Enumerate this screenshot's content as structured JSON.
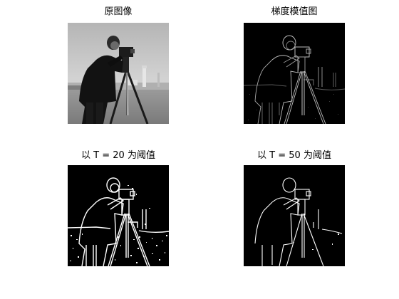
{
  "panels": [
    {
      "title": "原图像"
    },
    {
      "title": "梯度模值图"
    },
    {
      "title": "以 T = 20 为阈值"
    },
    {
      "title": "以 T = 50 为阈值"
    }
  ],
  "colors": {
    "background": "#ffffff",
    "title_text": "#000000",
    "image_black": "#000000",
    "image_white": "#ffffff",
    "original_sky": "#c9c9c9",
    "original_ground": "#8a8a8a"
  }
}
